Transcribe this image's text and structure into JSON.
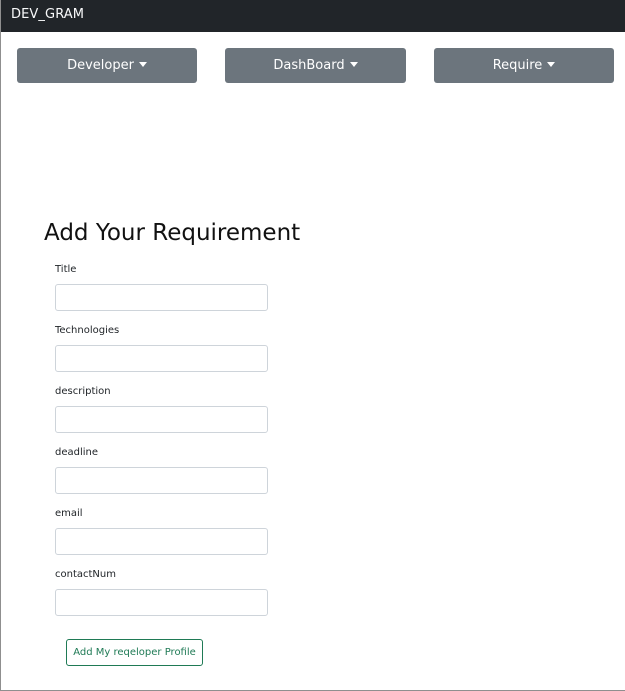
{
  "navbar": {
    "brand": "DEV_GRAM",
    "menus": [
      {
        "label": "Developer",
        "icon": "caret-down-icon"
      },
      {
        "label": "DashBoard",
        "icon": "caret-down-icon"
      },
      {
        "label": "Require",
        "icon": "caret-down-icon"
      }
    ]
  },
  "form": {
    "title": "Add Your Requirement",
    "fields": [
      {
        "label": "Title",
        "value": "",
        "placeholder": ""
      },
      {
        "label": "Technologies",
        "value": "",
        "placeholder": ""
      },
      {
        "label": "description",
        "value": "",
        "placeholder": ""
      },
      {
        "label": "deadline",
        "value": "",
        "placeholder": ""
      },
      {
        "label": "email",
        "value": "",
        "placeholder": ""
      },
      {
        "label": "contactNum",
        "value": "",
        "placeholder": ""
      }
    ],
    "submit_label": "Add My reqeloper Profile"
  },
  "colors": {
    "navbar_bg": "#212529",
    "menu_button_bg": "#6c757d",
    "submit_accent": "#1f7a55"
  }
}
